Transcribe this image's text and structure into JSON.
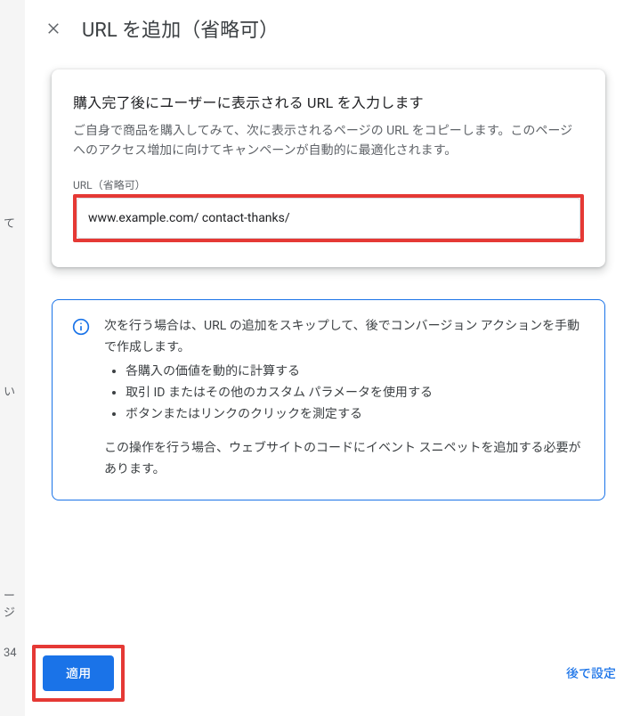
{
  "modal": {
    "title": "URL を追加（省略可）"
  },
  "card": {
    "title": "購入完了後にユーザーに表示される URL を入力します",
    "description": "ご自身で商品を購入してみて、次に表示されるページの URL をコピーします。このページへのアクセス増加に向けてキャンペーンが自動的に最適化されます。",
    "field_label": "URL（省略可）",
    "url_value": "www.example.com/ contact-thanks/"
  },
  "info": {
    "lead": "次を行う場合は、URL の追加をスキップして、後でコンバージョン アクションを手動で作成します。",
    "bullets": [
      "各購入の価値を動的に計算する",
      "取引 ID またはその他のカスタム パラメータを使用する",
      "ボタンまたはリンクのクリックを測定する"
    ],
    "trail": "この操作を行う場合、ウェブサイトのコードにイベント スニペットを追加する必要があります。"
  },
  "footer": {
    "apply": "適用",
    "later": "後で設定"
  },
  "backdrop": {
    "frag1": "て",
    "frag2": "い",
    "frag3": "ージ",
    "frag4": "34"
  }
}
